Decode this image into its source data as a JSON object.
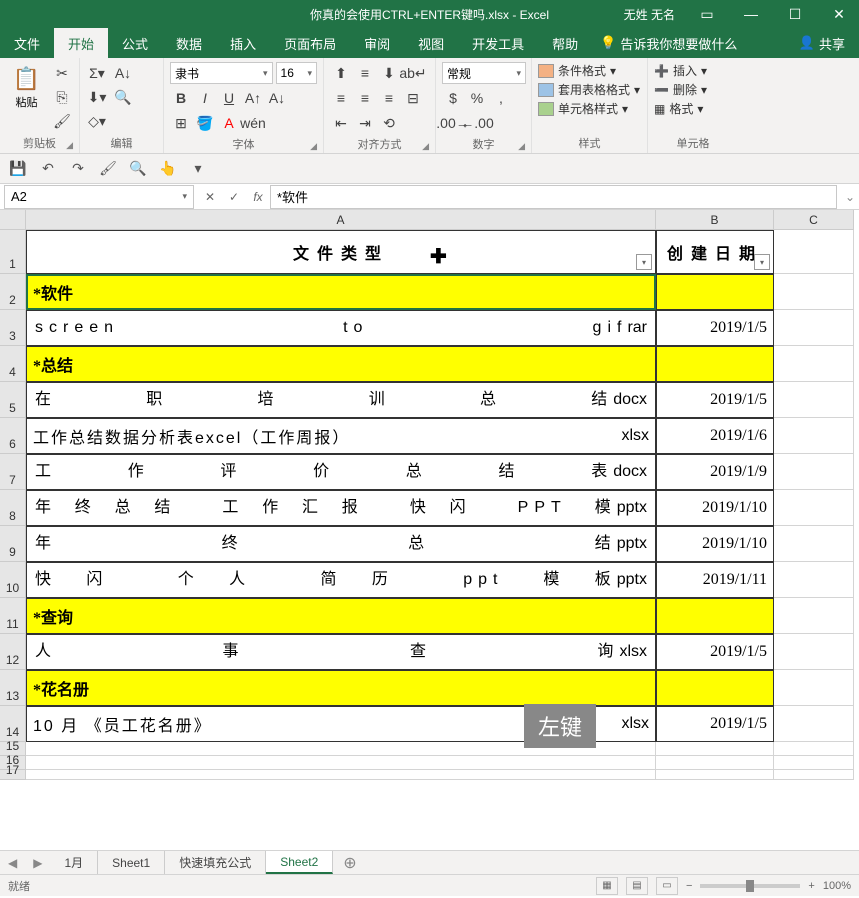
{
  "title": "你真的会使用CTRL+ENTER键吗.xlsx - Excel",
  "user": "无姓 无名",
  "menu": {
    "file": "文件",
    "home": "开始",
    "formulas": "公式",
    "data": "数据",
    "insert": "插入",
    "layout": "页面布局",
    "review": "审阅",
    "view": "视图",
    "dev": "开发工具",
    "help": "帮助",
    "tell": "告诉我你想要做什么",
    "share": "共享"
  },
  "ribbon": {
    "clipboard": {
      "label": "剪贴板",
      "paste": "粘贴"
    },
    "editing": {
      "label": "编辑"
    },
    "font": {
      "label": "字体",
      "name": "隶书",
      "size": "16"
    },
    "align": {
      "label": "对齐方式"
    },
    "number": {
      "label": "数字",
      "fmt": "常规"
    },
    "styles": {
      "label": "样式",
      "cf": "条件格式",
      "table": "套用表格格式",
      "cell": "单元格样式"
    },
    "cells": {
      "label": "单元格",
      "insert": "插入",
      "delete": "删除",
      "format": "格式"
    }
  },
  "namebox": "A2",
  "formula": "*软件",
  "cols": {
    "A": 630,
    "B": 118,
    "C": 80
  },
  "rowH": {
    "r1": 44,
    "r2": 36,
    "big": 36,
    "small": 14
  },
  "headers": {
    "A": "文件类型",
    "B": "创建日期"
  },
  "rows": [
    {
      "n": 2,
      "a": "*软件",
      "b": "",
      "y": true
    },
    {
      "n": 3,
      "a": "screen to gif",
      "ext": "rar",
      "b": "2019/1/5"
    },
    {
      "n": 4,
      "a": "*总结",
      "b": "",
      "y": true
    },
    {
      "n": 5,
      "a": "在职培训总结",
      "ext": "docx",
      "b": "2019/1/5"
    },
    {
      "n": 6,
      "a": "工作总结数据分析表excel（工作周报）",
      "ext": "xlsx",
      "b": "2019/1/6",
      "noj": true
    },
    {
      "n": 7,
      "a": "工作评价总结表",
      "ext": "docx",
      "b": "2019/1/9"
    },
    {
      "n": 8,
      "a": "年终总结 工作汇报 快闪 PPT 模",
      "ext": "pptx",
      "b": "2019/1/10"
    },
    {
      "n": 9,
      "a": "年终总结",
      "ext": "pptx",
      "b": "2019/1/10"
    },
    {
      "n": 10,
      "a": "快闪 个人 简历 ppt 模板",
      "ext": "pptx",
      "b": "2019/1/11"
    },
    {
      "n": 11,
      "a": "*查询",
      "b": "",
      "y": true
    },
    {
      "n": 12,
      "a": "人事查询",
      "ext": "xlsx",
      "b": "2019/1/5"
    },
    {
      "n": 13,
      "a": "*花名册",
      "b": "",
      "y": true
    },
    {
      "n": 14,
      "a": "10 月 《员工花名册》",
      "ext": "xlsx",
      "b": "2019/1/5",
      "noj": true
    }
  ],
  "sheets": {
    "s1": "1月",
    "s2": "Sheet1",
    "s3": "快速填充公式",
    "s4": "Sheet2"
  },
  "status": {
    "ready": "就绪",
    "zoom": "100%"
  },
  "watermark": "左键"
}
